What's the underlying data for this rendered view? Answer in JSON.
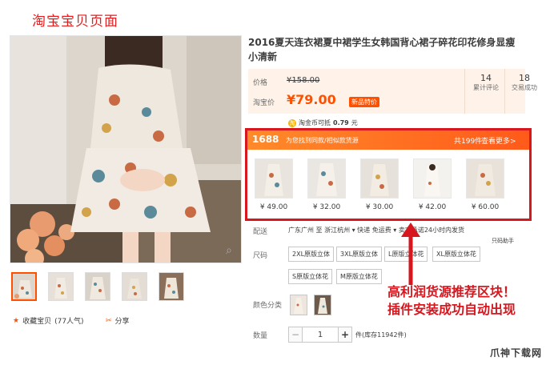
{
  "annotation_title": "淘宝宝贝页面",
  "product": {
    "title": "2016夏天连衣裙夏中裙学生女韩国背心裙子碎花印花修身显瘦小清新",
    "price_label": "价格",
    "old_price": "¥158.00",
    "taobao_price_label": "淘宝价",
    "new_price": "¥79.00",
    "new_badge": "新品特价",
    "reviews_count": "14",
    "reviews_label": "累计评论",
    "sales_count": "18",
    "sales_label": "交易成功",
    "coin_text": "淘金币可抵",
    "coin_value": "0.79",
    "coin_unit": "元"
  },
  "recommend": {
    "logo": "1688",
    "tagline": "为您找到同款/相似款货源",
    "count": "共199件",
    "more": "查看更多>",
    "items": [
      {
        "price": "¥ 49.00"
      },
      {
        "price": "¥ 32.00"
      },
      {
        "price": "¥ 30.00"
      },
      {
        "price": "¥ 42.00"
      },
      {
        "price": "¥ 60.00"
      }
    ]
  },
  "shipping": {
    "label": "配送",
    "text": "广东广州 至 浙江杭州 ▾   快递 免运费 ▾   卖家承诺24小时内发货",
    "helper": "只码助手"
  },
  "size": {
    "label": "尺码",
    "options": [
      "2XL原版立体",
      "3XL原版立体",
      "L原版立体花",
      "XL原版立体花",
      "S原版立体花",
      "M原版立体花"
    ]
  },
  "color": {
    "label": "颜色分类"
  },
  "quantity": {
    "label": "数量",
    "minus": "−",
    "value": "1",
    "plus": "+",
    "stock": "件(库存11942件)"
  },
  "actions": {
    "favorite": "收藏宝贝",
    "favorite_count": "(77人气)",
    "share": "分享"
  },
  "callout": {
    "line1": "高利润货源推荐区块！",
    "line2": "插件安装成功自动出现"
  },
  "watermark": "爪神下载网",
  "colors": {
    "accent": "#ff5000",
    "highlight": "#d7161e",
    "price_bg": "#fff2e8"
  }
}
